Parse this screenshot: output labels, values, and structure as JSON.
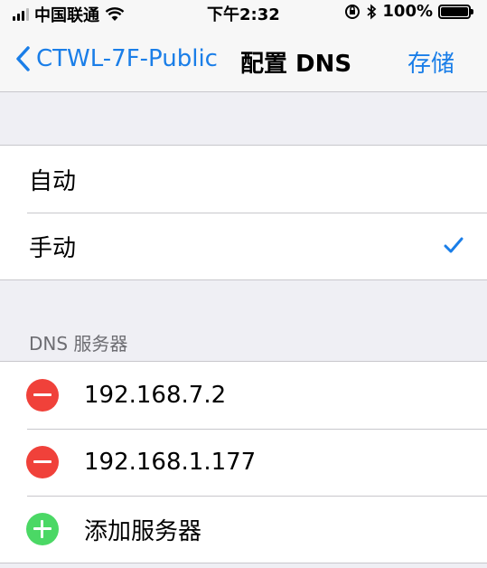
{
  "status_bar": {
    "carrier": "中国联通",
    "time": "下午2:32",
    "battery": "100%",
    "battery_level": 1.0
  },
  "nav": {
    "back_label": "CTWL-7F-Public",
    "title": "配置 DNS",
    "save_label": "存储"
  },
  "mode": {
    "options": [
      {
        "label": "自动",
        "selected": false
      },
      {
        "label": "手动",
        "selected": true
      }
    ]
  },
  "dns_section": {
    "header": "DNS 服务器",
    "servers": [
      "192.168.7.2",
      "192.168.1.177"
    ],
    "add_label": "添加服务器"
  },
  "colors": {
    "accent": "#1a7ee8",
    "delete": "#f0413a",
    "add": "#4bd865",
    "background": "#efeff4"
  }
}
